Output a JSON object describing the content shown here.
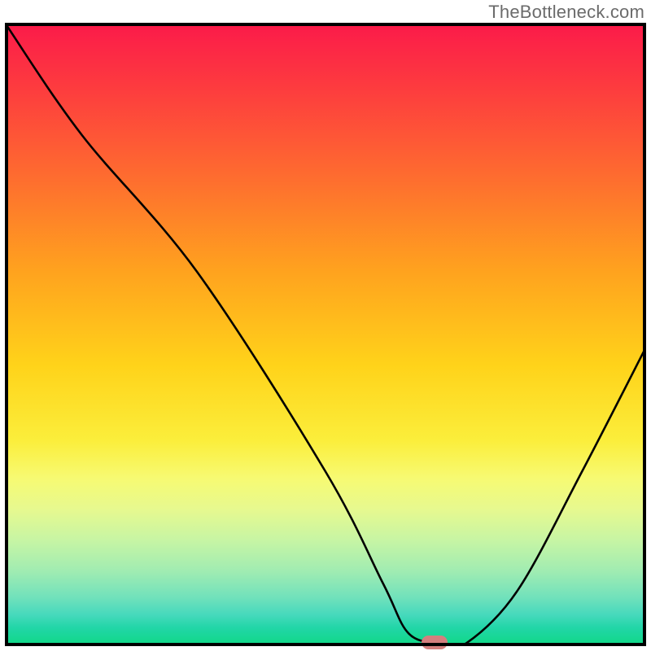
{
  "watermark": "TheBottleneck.com",
  "chart_data": {
    "type": "line",
    "title": "",
    "xlabel": "",
    "ylabel": "",
    "xlim": [
      0,
      100
    ],
    "ylim": [
      0,
      100
    ],
    "grid": false,
    "legend": false,
    "series": [
      {
        "name": "bottleneck-curve",
        "x": [
          0,
          12,
          30,
          50,
          59,
          63,
          68,
          72,
          80,
          90,
          100
        ],
        "values": [
          100,
          82,
          60,
          28,
          10,
          2,
          0.5,
          0.5,
          9,
          28,
          48
        ]
      }
    ],
    "marker": {
      "x": 67,
      "y": 0.5
    },
    "gradient_stops": [
      {
        "pos": 0.0,
        "color": "#fb1a4a"
      },
      {
        "pos": 0.1,
        "color": "#fd3a3f"
      },
      {
        "pos": 0.25,
        "color": "#fe6d2f"
      },
      {
        "pos": 0.4,
        "color": "#ffa31e"
      },
      {
        "pos": 0.55,
        "color": "#ffd31a"
      },
      {
        "pos": 0.67,
        "color": "#fbee3b"
      },
      {
        "pos": 0.73,
        "color": "#f7fa72"
      },
      {
        "pos": 0.78,
        "color": "#e7f98f"
      },
      {
        "pos": 0.83,
        "color": "#c7f5a4"
      },
      {
        "pos": 0.88,
        "color": "#a0ecb2"
      },
      {
        "pos": 0.92,
        "color": "#73e2bb"
      },
      {
        "pos": 0.95,
        "color": "#46d9bc"
      },
      {
        "pos": 0.97,
        "color": "#22d6a8"
      },
      {
        "pos": 1.0,
        "color": "#0fd884"
      }
    ]
  }
}
